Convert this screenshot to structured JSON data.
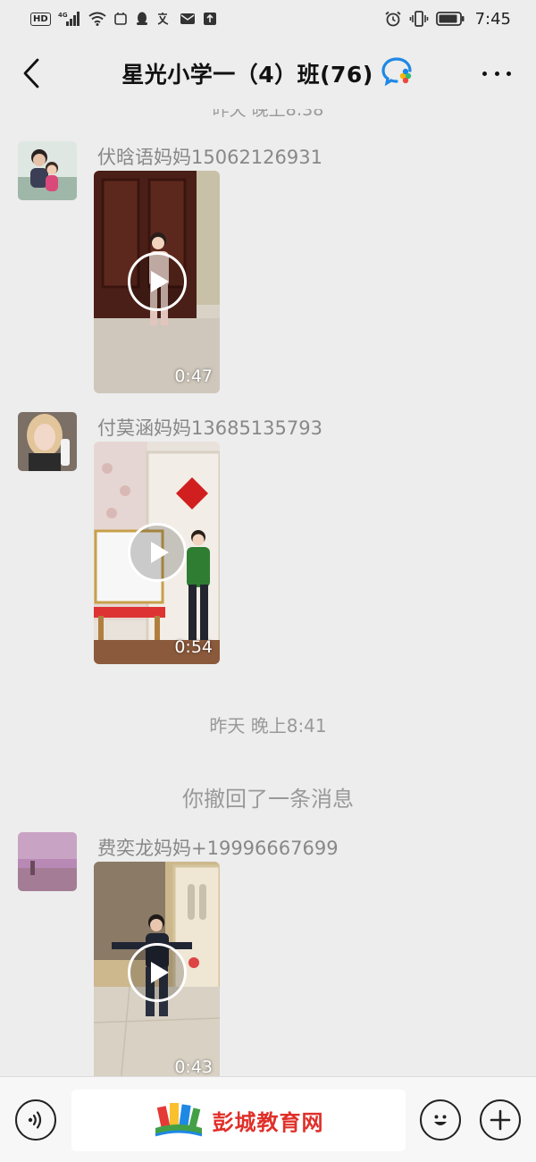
{
  "status_bar": {
    "network_badge": "HD",
    "network_type": "4G",
    "time": "7:45"
  },
  "header": {
    "title": "星光小学一（4）班(76)",
    "back_icon": "chevron-left-icon",
    "more_icon": "more-dots-icon"
  },
  "chat": {
    "partial_timestamp": "昨天 晚上8:38",
    "messages": [
      {
        "sender": "伏晗语妈妈15062126931",
        "duration": "0:47"
      },
      {
        "sender": "付莫涵妈妈13685135793",
        "duration": "0:54"
      },
      {
        "sender": "费奕龙妈妈+19996667699",
        "duration": "0:43"
      }
    ],
    "timestamp": "昨天 晚上8:41",
    "recall_notice": "你撤回了一条消息"
  },
  "input_bar": {
    "voice_icon": "voice-icon",
    "emoji_icon": "emoji-icon",
    "plus_icon": "plus-icon",
    "watermark_text": "彭城教育网"
  },
  "colors": {
    "background": "#ededed",
    "input_bar": "#f7f7f7",
    "watermark": "#e0302a",
    "meta_text": "#888888"
  }
}
